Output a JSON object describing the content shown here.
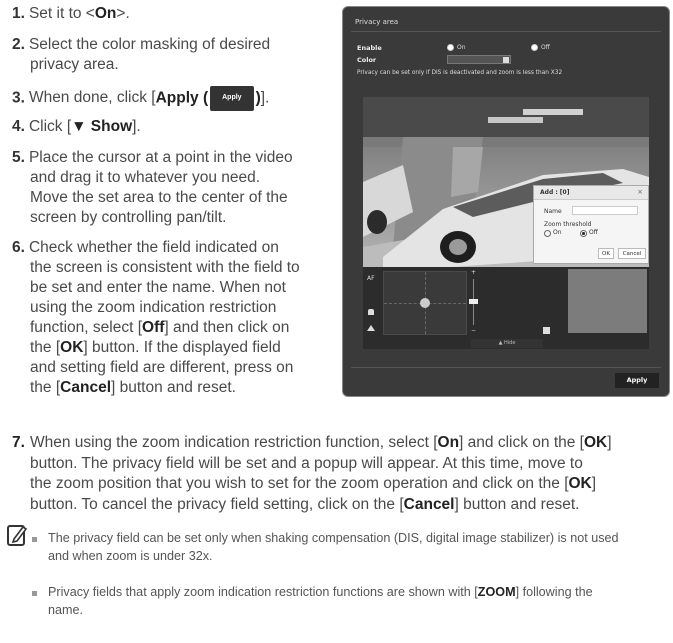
{
  "steps": [
    {
      "num": "1.",
      "text": "Set it to <",
      "bold": "On",
      "tail": ">."
    },
    {
      "num": "2.",
      "line1": "Select the color masking of desired",
      "line2": "privacy area."
    },
    {
      "num": "3.",
      "pre": "When done, click [",
      "bold": "Apply (",
      "btn": "Apply",
      "bold2": ")",
      "tail": "]."
    },
    {
      "num": "4.",
      "pre": "Click [",
      "bold": "▼ Show",
      "tail": "]."
    },
    {
      "num": "5.",
      "lines": [
        "Place the cursor at a point in the video",
        "and drag it to whatever you need.",
        "Move the set area to the center of the",
        "screen by controlling pan/tilt."
      ]
    },
    {
      "num": "6."
    }
  ],
  "step6": {
    "l1": "Check whether the field indicated on",
    "l2": "the screen is consistent with the field to",
    "l3": "be set and enter the name. When not",
    "l4": "using the zoom indication restriction",
    "l5a": "function, select [",
    "l5b": "Off",
    "l5c": "] and then click on",
    "l6a": "the [",
    "l6b": "OK",
    "l6c": "] button. If the displayed field",
    "l7": "and setting field are different, press on",
    "l8a": "the [",
    "l8b": "Cancel",
    "l8c": "] button and reset."
  },
  "step7": {
    "num": "7.",
    "l1a": "When using the zoom indication restriction function, select [",
    "l1b": "On",
    "l1c": "] and click on the [",
    "l1d": "OK",
    "l1e": "]",
    "l2": "button. The privacy field will be set and a popup will appear. At this time, move to",
    "l3a": "the zoom position that you wish to set for the zoom operation and click on the [",
    "l3b": "OK",
    "l3c": "]",
    "l4a": "button. To cancel the privacy field setting, click on the [",
    "l4b": "Cancel",
    "l4c": "] button and reset."
  },
  "notes": {
    "n1a": "The privacy field can be set only when shaking compensation (DIS, digital image stabilizer) is not used",
    "n1b": "and when zoom is under 32x.",
    "n2a": "Privacy fields that apply zoom indication restriction functions are shown with [",
    "n2b": "ZOOM",
    "n2c": "] following the",
    "n2d": "name."
  },
  "ui": {
    "title": "Privacy area",
    "enable": "Enable",
    "on": "On",
    "off": "Off",
    "color": "Color",
    "note": "Privacy can be set only if DIS is deactivated and zoom is less than X32",
    "af": "AF",
    "plus": "+",
    "minus": "−",
    "hide": "▲ Hide",
    "apply": "Apply",
    "popup": {
      "title": "Add : [0]",
      "close": "×",
      "name_label": "Name",
      "zoom": "Zoom threshold",
      "on": "On",
      "off": "Off",
      "ok": "OK",
      "cancel": "Cancel"
    }
  },
  "colors": {
    "panel": "#3a3a3a",
    "accent": "#222222"
  }
}
